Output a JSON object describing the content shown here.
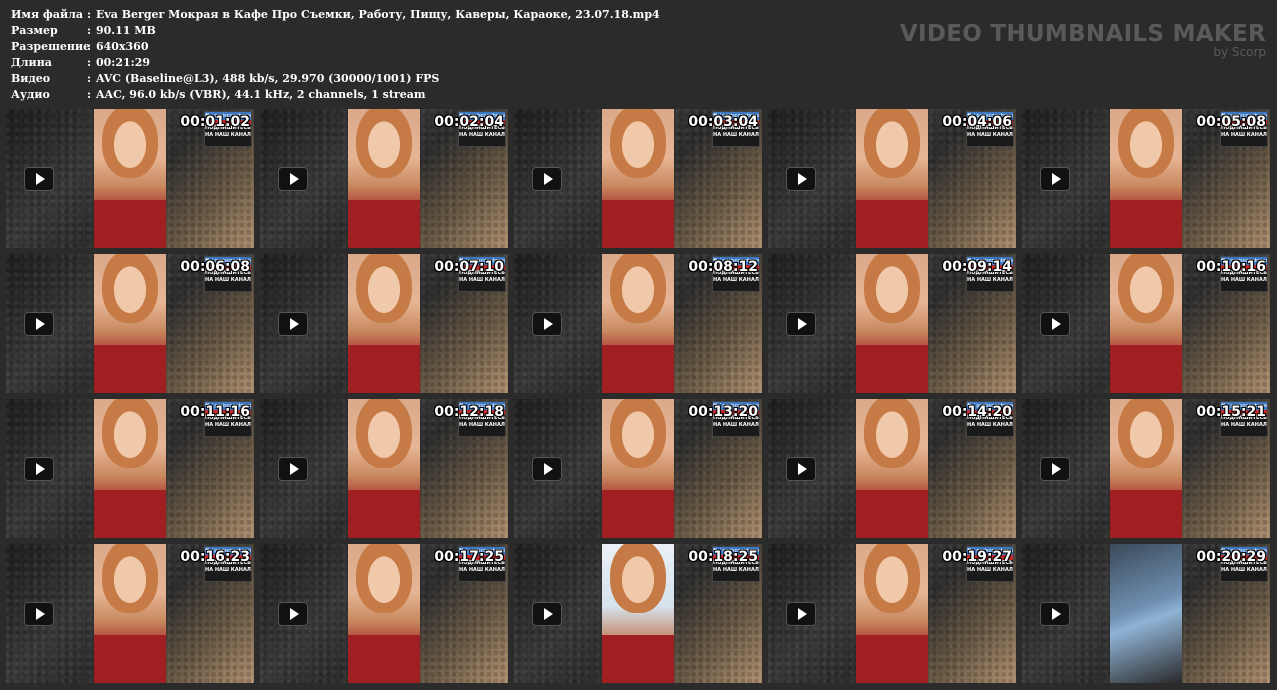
{
  "meta": {
    "rows": [
      {
        "label": "Имя файла",
        "value": "Eva Berger Мокрая в Кафе Про Съемки, Работу, Пищу, Каверы, Караоке, 23.07.18.mp4"
      },
      {
        "label": "Размер",
        "value": "90.11 MB"
      },
      {
        "label": "Разрешение",
        "value": "640x360"
      },
      {
        "label": "Длина",
        "value": "00:21:29"
      },
      {
        "label": "Видео",
        "value": "AVC (Baseline@L3), 488 kb/s, 29.970 (30000/1001) FPS"
      },
      {
        "label": "Аудио",
        "value": "AAC, 96.0 kb/s (VBR), 44.1 kHz, 2 channels, 1 stream"
      }
    ],
    "separator": ":"
  },
  "brand": {
    "title": "VIDEO THUMBNAILS MAKER",
    "subtitle": "by Scorp"
  },
  "badge": {
    "top": "♥ / periscopebroad",
    "line1": "ПОДПИШИТЕСЬ",
    "line2": "НА НАШ КАНАЛ"
  },
  "thumbnails": [
    {
      "time": "00:01:02",
      "scene": "face"
    },
    {
      "time": "00:02:04",
      "scene": "face"
    },
    {
      "time": "00:03:04",
      "scene": "face"
    },
    {
      "time": "00:04:06",
      "scene": "face"
    },
    {
      "time": "00:05:08",
      "scene": "face"
    },
    {
      "time": "00:06:08",
      "scene": "face"
    },
    {
      "time": "00:07:10",
      "scene": "face"
    },
    {
      "time": "00:08:12",
      "scene": "face"
    },
    {
      "time": "00:09:14",
      "scene": "face"
    },
    {
      "time": "00:10:16",
      "scene": "face"
    },
    {
      "time": "00:11:16",
      "scene": "face"
    },
    {
      "time": "00:12:18",
      "scene": "face"
    },
    {
      "time": "00:13:20",
      "scene": "face"
    },
    {
      "time": "00:14:20",
      "scene": "face"
    },
    {
      "time": "00:15:21",
      "scene": "face"
    },
    {
      "time": "00:16:23",
      "scene": "face"
    },
    {
      "time": "00:17:25",
      "scene": "face"
    },
    {
      "time": "00:18:25",
      "scene": "sky"
    },
    {
      "time": "00:19:27",
      "scene": "face"
    },
    {
      "time": "00:20:29",
      "scene": "window"
    }
  ]
}
